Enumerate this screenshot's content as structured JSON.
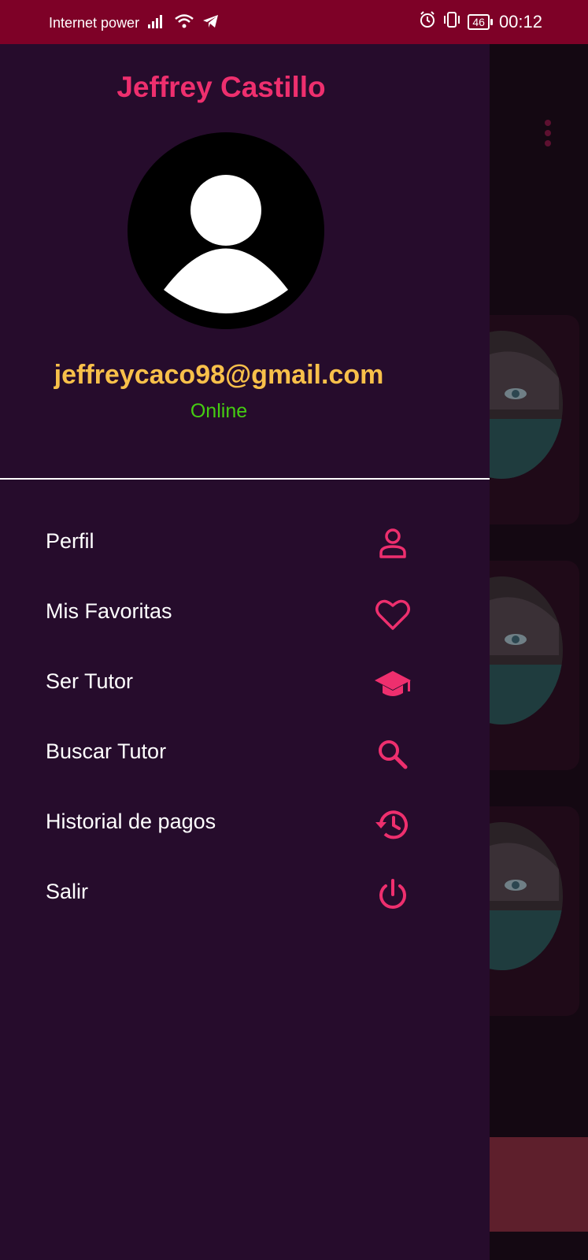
{
  "status_bar": {
    "carrier": "Internet power",
    "battery": "46",
    "time": "00:12",
    "icons": [
      "signal-icon",
      "wifi-icon",
      "telegram-icon",
      "alarm-icon",
      "vibrate-icon",
      "battery-icon"
    ]
  },
  "drawer": {
    "user_name": "Jeffrey Castillo",
    "email": "jeffreycaco98@gmail.com",
    "status": "Online",
    "menu": [
      {
        "label": "Perfil",
        "icon": "person-icon"
      },
      {
        "label": "Mis Favoritas",
        "icon": "heart-icon"
      },
      {
        "label": "Ser Tutor",
        "icon": "graduation-cap-icon"
      },
      {
        "label": "Buscar Tutor",
        "icon": "search-icon"
      },
      {
        "label": "Historial de pagos",
        "icon": "history-icon"
      },
      {
        "label": "Salir",
        "icon": "power-icon"
      }
    ]
  },
  "colors": {
    "status_bar": "#7e0127",
    "drawer_bg": "#260c2c",
    "accent": "#ee2f6e",
    "email": "#f8c04a",
    "online": "#45cd12"
  }
}
